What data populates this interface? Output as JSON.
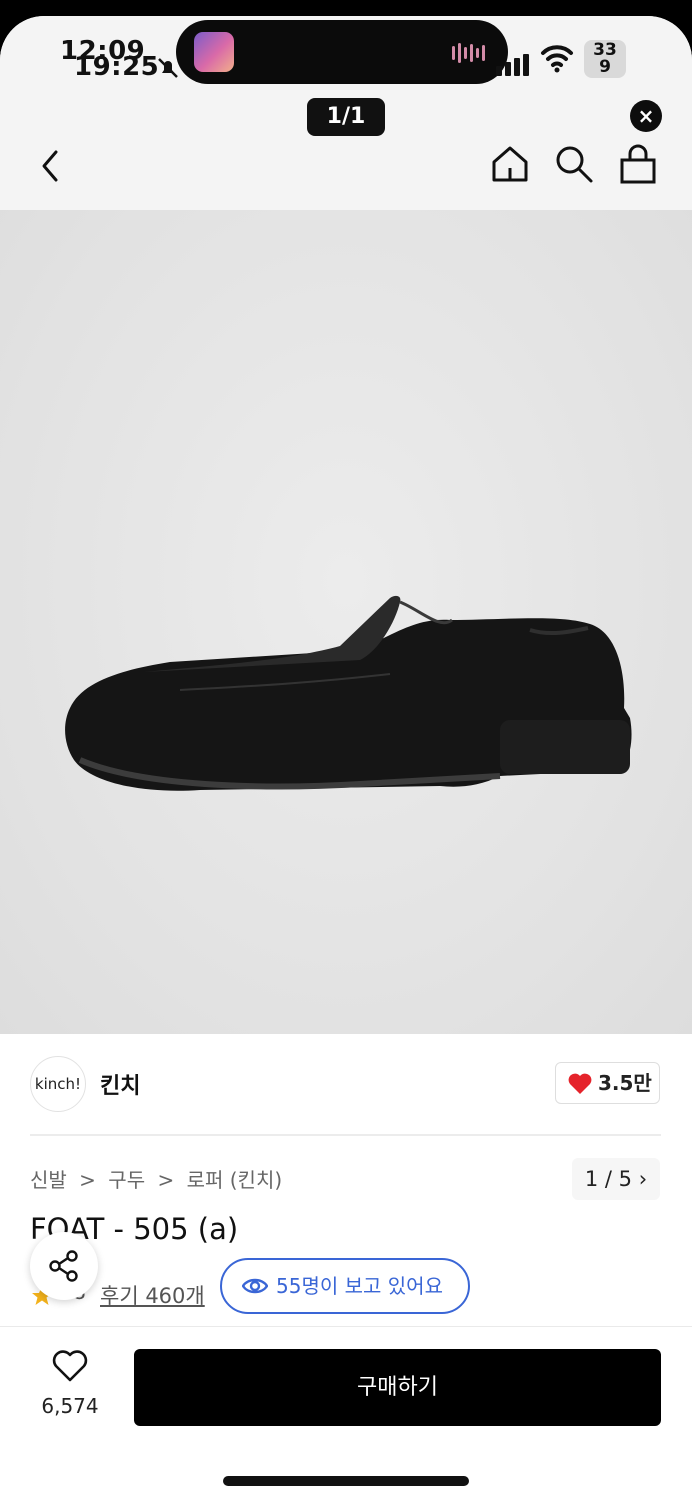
{
  "status_bar": {
    "time_back": "12:09",
    "time_front": "19:25",
    "battery_top": "33",
    "battery_bottom": "9"
  },
  "viewer": {
    "page_indicator": "1/1",
    "close_glyph": "×"
  },
  "nav": {
    "icons": [
      "back-icon",
      "home-icon",
      "search-icon",
      "shopping-bag-icon"
    ]
  },
  "product_image": {
    "counter": "1 / 5"
  },
  "brand": {
    "logo_text": "kinch!",
    "name": "킨치",
    "likes": "3.5만",
    "like_color": "#e5232b"
  },
  "breadcrumb": [
    "신발",
    ">",
    "구두",
    ">",
    "로퍼 (킨치)"
  ],
  "product": {
    "title": "FOAT - 505 (a)",
    "rating": ".8",
    "reviews": "후기 460개",
    "viewers": "55명이 보고 있어요",
    "accent": "#3a66d6"
  },
  "bottom_bar": {
    "wish_count": "6,574",
    "buy_label": "구매하기"
  }
}
